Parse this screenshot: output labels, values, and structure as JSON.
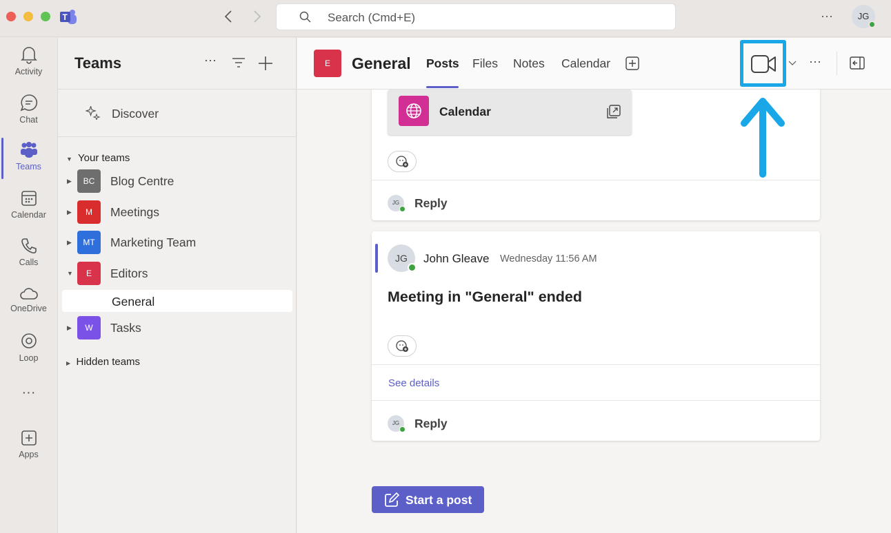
{
  "titlebar": {
    "search_placeholder": "Search (Cmd+E)",
    "user_initials": "JG"
  },
  "rail": {
    "items": [
      {
        "label": "Activity"
      },
      {
        "label": "Chat"
      },
      {
        "label": "Teams"
      },
      {
        "label": "Calendar"
      },
      {
        "label": "Calls"
      },
      {
        "label": "OneDrive"
      },
      {
        "label": "Loop"
      },
      {
        "label": "Apps"
      }
    ]
  },
  "teams_panel": {
    "title": "Teams",
    "discover": "Discover",
    "your_teams": "Your teams",
    "hidden_teams": "Hidden teams",
    "teams": [
      {
        "initials": "BC",
        "name": "Blog Centre",
        "color": "#6e6e6e"
      },
      {
        "initials": "M",
        "name": "Meetings",
        "color": "#d92c2c"
      },
      {
        "initials": "MT",
        "name": "Marketing Team",
        "color": "#2f6fdb"
      },
      {
        "initials": "E",
        "name": "Editors",
        "color": "#d8334a"
      },
      {
        "initials": "W",
        "name": "Tasks",
        "color": "#7a52e8"
      }
    ],
    "selected_channel": "General"
  },
  "channel": {
    "avatar": "E",
    "name": "General",
    "tabs": [
      "Posts",
      "Files",
      "Notes",
      "Calendar"
    ],
    "active_tab": "Posts"
  },
  "posts": {
    "calendar_card": {
      "title": "Calendar"
    },
    "reply_label": "Reply",
    "reply_avatar": "JG",
    "message": {
      "author": "John Gleave",
      "initials": "JG",
      "time": "Wednesday 11:56 AM",
      "text": "Meeting in \"General\" ended",
      "see_details": "See details"
    },
    "start_post": "Start a post"
  },
  "colors": {
    "accent": "#5b5fc7",
    "annotation": "#1aa7e8"
  }
}
